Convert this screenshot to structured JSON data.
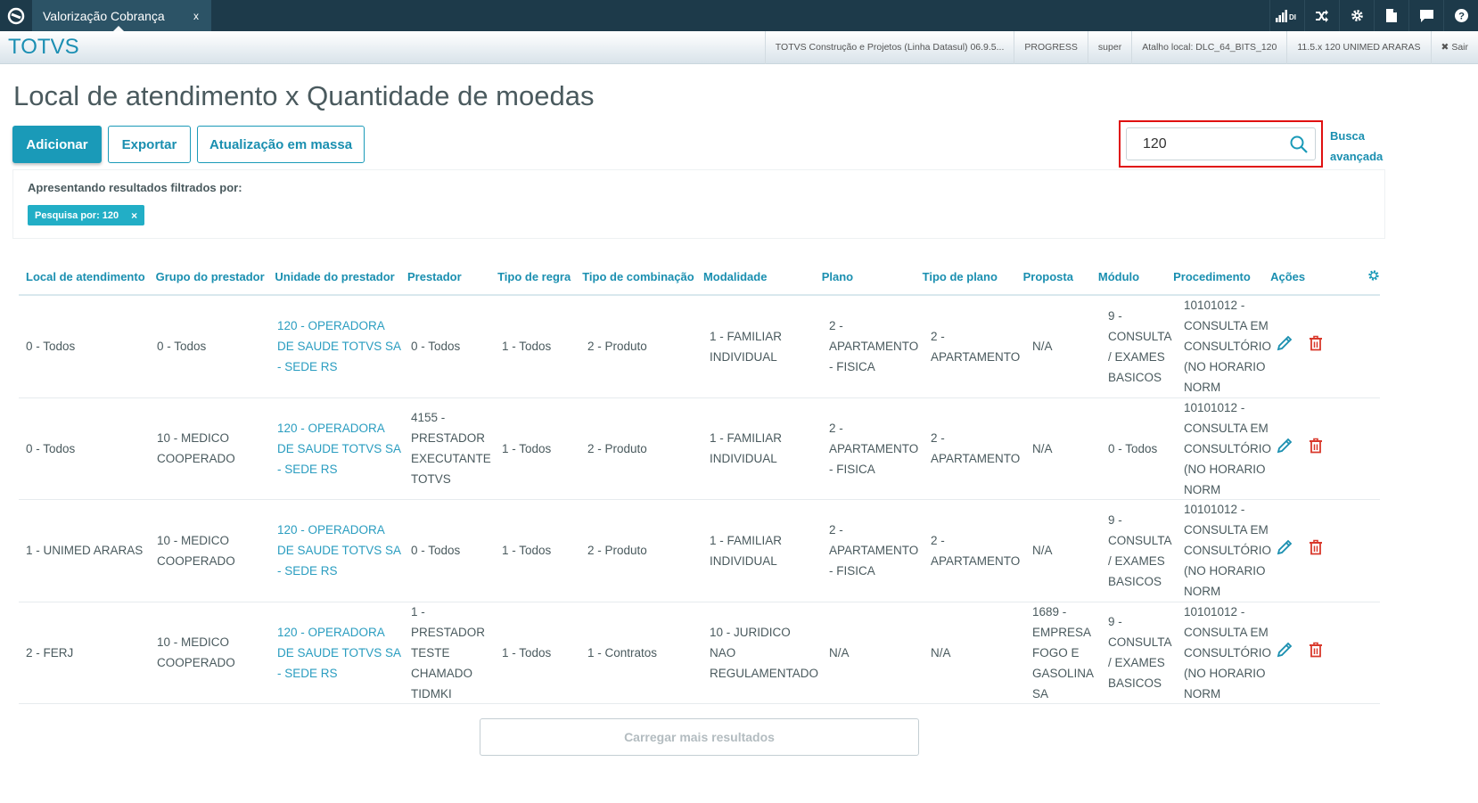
{
  "topbar": {
    "tab_title": "Valorização Cobrança",
    "tab_close": "x",
    "signal_label": "DI",
    "colors": {
      "bar": "#1d3a4a",
      "tab": "#2c5366"
    }
  },
  "header": {
    "brand": "TOTVS",
    "product": "TOTVS Construção e Projetos (Linha Datasul) 06.9.5...",
    "database": "PROGRESS",
    "user": "super",
    "shortcut": "Atalho local: DLC_64_BITS_120",
    "company": "11.5.x 120 UNIMED ARARAS",
    "logout": "Sair"
  },
  "page": {
    "title": "Local de atendimento x Quantidade de moedas",
    "buttons": {
      "add": "Adicionar",
      "export": "Exportar",
      "bulk_update": "Atualização em massa"
    },
    "search": {
      "value": "120"
    },
    "advanced_search_line1": "Busca",
    "advanced_search_line2": "avançada",
    "filters": {
      "label": "Apresentando resultados filtrados por:",
      "chip": "Pesquisa por: 120",
      "chip_close": "×"
    },
    "load_more": "Carregar mais resultados",
    "accent_color": "#1a9ab8"
  },
  "table": {
    "columns": [
      "Local de atendimento",
      "Grupo do prestador",
      "Unidade do prestador",
      "Prestador",
      "Tipo de regra",
      "Tipo de combinação",
      "Modalidade",
      "Plano",
      "Tipo de plano",
      "Proposta",
      "Módulo",
      "Procedimento",
      "Ações"
    ],
    "rows": [
      {
        "local": "0 - Todos",
        "grupo": [
          "0 - Todos"
        ],
        "unidade": [
          "120 - OPERADORA",
          "DE SAUDE TOTVS SA",
          "- SEDE RS"
        ],
        "prestador": [
          "0 - Todos"
        ],
        "tipo_regra": "1 - Todos",
        "tipo_combinacao": "2 - Produto",
        "modalidade": [
          "1 - FAMILIAR",
          "INDIVIDUAL"
        ],
        "plano": [
          "2 -",
          "APARTAMENTO",
          "- FISICA"
        ],
        "tipo_plano": [
          "2 -",
          "APARTAMENTO"
        ],
        "proposta": [
          "N/A"
        ],
        "modulo": [
          "9 -",
          "CONSULTA",
          "/ EXAMES",
          "BASICOS"
        ],
        "procedimento": [
          "10101012 -",
          "CONSULTA EM",
          "CONSULTÓRIO",
          "(NO HORARIO",
          "NORM"
        ]
      },
      {
        "local": "0 - Todos",
        "grupo": [
          "10 - MEDICO",
          "COOPERADO"
        ],
        "unidade": [
          "120 - OPERADORA",
          "DE SAUDE TOTVS SA",
          "- SEDE RS"
        ],
        "prestador": [
          "4155 -",
          "PRESTADOR",
          "EXECUTANTE",
          "TOTVS"
        ],
        "tipo_regra": "1 - Todos",
        "tipo_combinacao": "2 - Produto",
        "modalidade": [
          "1 - FAMILIAR",
          "INDIVIDUAL"
        ],
        "plano": [
          "2 -",
          "APARTAMENTO",
          "- FISICA"
        ],
        "tipo_plano": [
          "2 -",
          "APARTAMENTO"
        ],
        "proposta": [
          "N/A"
        ],
        "modulo": [
          "0 - Todos"
        ],
        "procedimento": [
          "10101012 -",
          "CONSULTA EM",
          "CONSULTÓRIO",
          "(NO HORARIO",
          "NORM"
        ]
      },
      {
        "local": "1 - UNIMED ARARAS",
        "grupo": [
          "10 - MEDICO",
          "COOPERADO"
        ],
        "unidade": [
          "120 - OPERADORA",
          "DE SAUDE TOTVS SA",
          "- SEDE RS"
        ],
        "prestador": [
          "0 - Todos"
        ],
        "tipo_regra": "1 - Todos",
        "tipo_combinacao": "2 - Produto",
        "modalidade": [
          "1 - FAMILIAR",
          "INDIVIDUAL"
        ],
        "plano": [
          "2 -",
          "APARTAMENTO",
          "- FISICA"
        ],
        "tipo_plano": [
          "2 -",
          "APARTAMENTO"
        ],
        "proposta": [
          "N/A"
        ],
        "modulo": [
          "9 -",
          "CONSULTA",
          "/ EXAMES",
          "BASICOS"
        ],
        "procedimento": [
          "10101012 -",
          "CONSULTA EM",
          "CONSULTÓRIO",
          "(NO HORARIO",
          "NORM"
        ]
      },
      {
        "local": "2 - FERJ",
        "grupo": [
          "10 - MEDICO",
          "COOPERADO"
        ],
        "unidade": [
          "120 - OPERADORA",
          "DE SAUDE TOTVS SA",
          "- SEDE RS"
        ],
        "prestador": [
          "1 -",
          "PRESTADOR",
          "TESTE",
          "CHAMADO",
          "TIDMKI"
        ],
        "tipo_regra": "1 - Todos",
        "tipo_combinacao": "1 - Contratos",
        "modalidade": [
          "10 - JURIDICO",
          "NAO",
          "REGULAMENTADO"
        ],
        "plano": [
          "N/A"
        ],
        "tipo_plano": [
          "N/A"
        ],
        "proposta": [
          "1689 -",
          "EMPRESA",
          "FOGO E",
          "GASOLINA",
          "SA"
        ],
        "modulo": [
          "9 -",
          "CONSULTA",
          "/ EXAMES",
          "BASICOS"
        ],
        "procedimento": [
          "10101012 -",
          "CONSULTA EM",
          "CONSULTÓRIO",
          "(NO HORARIO",
          "NORM"
        ]
      }
    ]
  }
}
